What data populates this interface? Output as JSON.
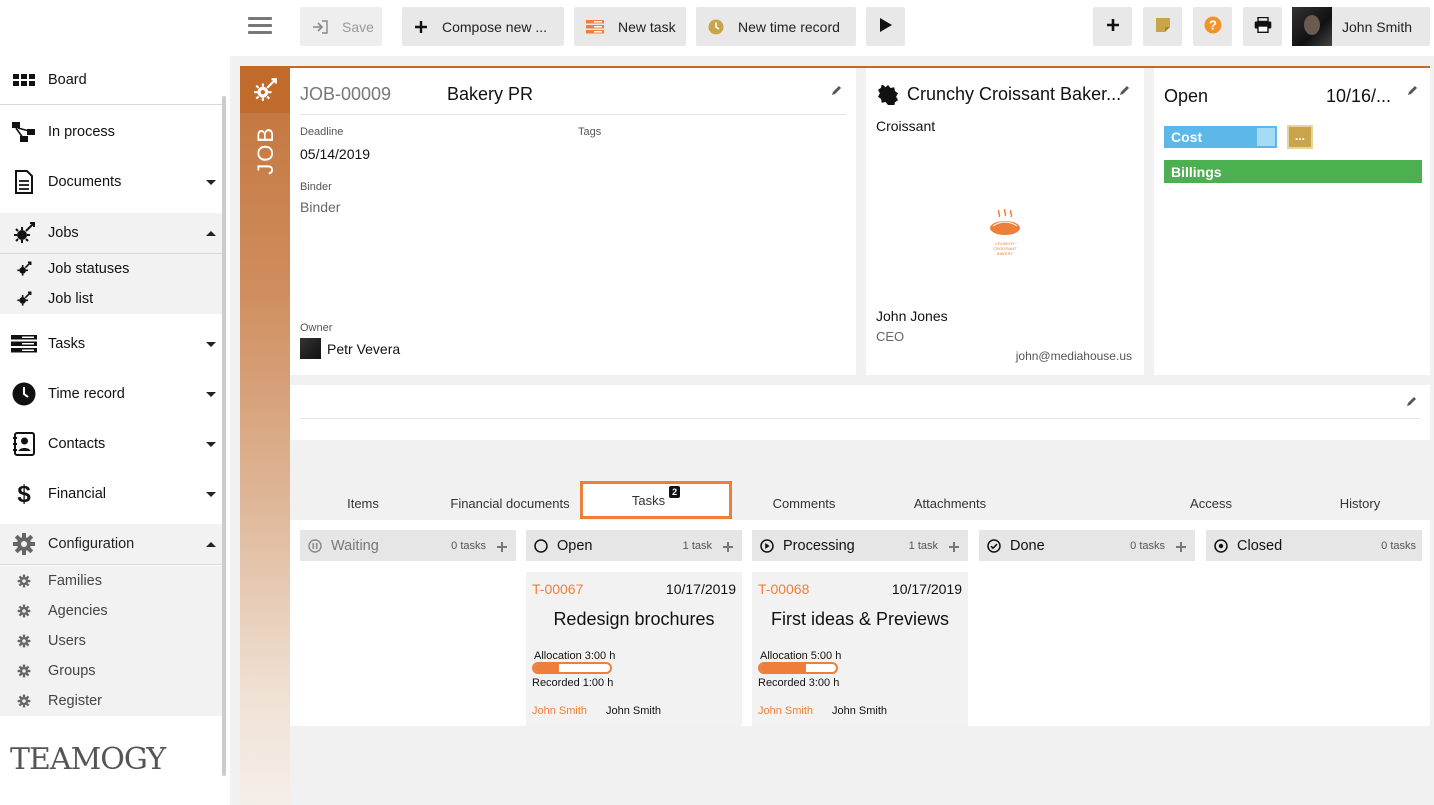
{
  "toolbar": {
    "save_label": "Save",
    "compose_label": "Compose new ...",
    "new_task_label": "New task",
    "new_time_record_label": "New time record",
    "user_name": "John Smith"
  },
  "sidebar": {
    "items": [
      {
        "label": "Board",
        "icon": "board-icon"
      },
      {
        "label": "In process",
        "icon": "process-icon"
      },
      {
        "label": "Documents",
        "icon": "document-icon"
      },
      {
        "label": "Jobs",
        "icon": "jobs-icon"
      },
      {
        "label": "Job statuses",
        "icon": "jobs-icon"
      },
      {
        "label": "Job list",
        "icon": "jobs-icon"
      },
      {
        "label": "Tasks",
        "icon": "tasks-icon"
      },
      {
        "label": "Time record",
        "icon": "clock-icon"
      },
      {
        "label": "Contacts",
        "icon": "contacts-icon"
      },
      {
        "label": "Financial",
        "icon": "dollar-icon"
      },
      {
        "label": "Configuration",
        "icon": "gear-icon"
      },
      {
        "label": "Families",
        "icon": "gear-icon"
      },
      {
        "label": "Agencies",
        "icon": "gear-icon"
      },
      {
        "label": "Users",
        "icon": "gear-icon"
      },
      {
        "label": "Groups",
        "icon": "gear-icon"
      },
      {
        "label": "Register",
        "icon": "gear-icon"
      }
    ],
    "logo_text": "TEAMOGY"
  },
  "job": {
    "strip_label": "JOB",
    "id": "JOB-00009",
    "title": "Bakery PR",
    "deadline_label": "Deadline",
    "deadline": "05/14/2019",
    "tags_label": "Tags",
    "binder_label": "Binder",
    "binder": "Binder",
    "owner_label": "Owner",
    "owner": "Petr Vevera"
  },
  "client": {
    "name": "Crunchy Croissant Baker...",
    "subtitle": "Croissant",
    "logo_line1": "CRUNCHY",
    "logo_line2": "CROISSANT",
    "logo_line3": "BAKERY",
    "contact_name": "John Jones",
    "contact_role": "CEO",
    "contact_email": "john@mediahouse.us"
  },
  "status": {
    "state": "Open",
    "date": "10/16/...",
    "cost_label": "Cost",
    "more_label": "...",
    "billings_label": "Billings"
  },
  "tabs": {
    "items": "Items",
    "financial": "Financial documents",
    "tasks": "Tasks",
    "tasks_count": "2",
    "comments": "Comments",
    "attachments": "Attachments",
    "access": "Access",
    "history": "History"
  },
  "columns": [
    {
      "name": "Waiting",
      "count": "0 tasks"
    },
    {
      "name": "Open",
      "count": "1 task"
    },
    {
      "name": "Processing",
      "count": "1 task"
    },
    {
      "name": "Done",
      "count": "0 tasks"
    },
    {
      "name": "Closed",
      "count": "0 tasks"
    }
  ],
  "tasks": [
    {
      "id": "T-00067",
      "date": "10/17/2019",
      "title": "Redesign brochures",
      "allocation": "Allocation 3:00 h",
      "recorded": "Recorded 1:00 h",
      "progress": 0.33,
      "assignee": "John Smith",
      "owner": "John Smith"
    },
    {
      "id": "T-00068",
      "date": "10/17/2019",
      "title": "First ideas & Previews",
      "allocation": "Allocation 5:00 h",
      "recorded": "Recorded 3:00 h",
      "progress": 0.6,
      "assignee": "John Smith",
      "owner": "John Smith"
    }
  ],
  "colors": {
    "accent": "#ee7f3b",
    "job": "#c06a2c",
    "cost": "#5bb8e8",
    "billings": "#4caf50",
    "note": "#c9a44b"
  }
}
